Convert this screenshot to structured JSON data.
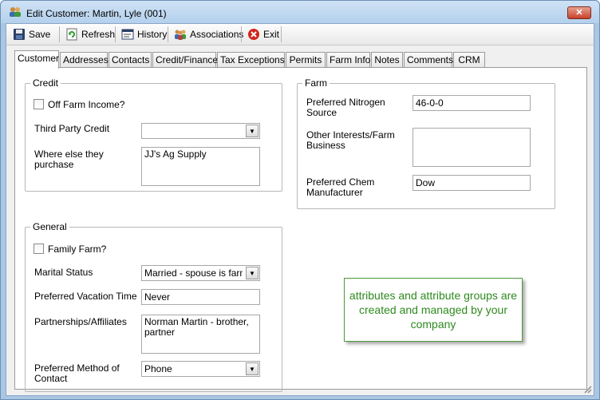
{
  "window": {
    "title": "Edit Customer: Martin, Lyle (001)",
    "close_glyph": "✕"
  },
  "toolbar": {
    "save": "Save",
    "refresh": "Refresh",
    "history": "History",
    "associations": "Associations",
    "exit": "Exit"
  },
  "tabs": [
    {
      "label": "Customer",
      "active": true
    },
    {
      "label": "Addresses"
    },
    {
      "label": "Contacts"
    },
    {
      "label": "Credit/Finance"
    },
    {
      "label": "Tax Exceptions"
    },
    {
      "label": "Permits"
    },
    {
      "label": "Farm Info"
    },
    {
      "label": "Notes"
    },
    {
      "label": "Comments"
    },
    {
      "label": "CRM"
    }
  ],
  "credit": {
    "title": "Credit",
    "off_farm_label": "Off Farm Income?",
    "off_farm_checked": false,
    "third_party_label": "Third Party Credit",
    "third_party_value": "",
    "where_else_label": "Where else they purchase",
    "where_else_value": "JJ's Ag Supply"
  },
  "general": {
    "title": "General",
    "family_farm_label": "Family Farm?",
    "family_farm_checked": false,
    "marital_label": "Marital Status",
    "marital_value": "Married - spouse is farm partner",
    "vacation_label": "Preferred Vacation Time",
    "vacation_value": "Never",
    "partnerships_label": "Partnerships/Affiliates",
    "partnerships_value": "Norman Martin - brother, partner",
    "contact_label": "Preferred Method of Contact",
    "contact_value": "Phone"
  },
  "farm": {
    "title": "Farm",
    "nitrogen_label": "Preferred Nitrogen Source",
    "nitrogen_value": "46-0-0",
    "interests_label": "Other Interests/Farm Business",
    "interests_value": "",
    "chem_label": "Preferred Chem Manufacturer",
    "chem_value": "Dow"
  },
  "callout": {
    "text": "attributes and attribute groups are created and managed by your company"
  },
  "colors": {
    "title_bar": "#b4d0ec",
    "callout_text": "#2e8a1e",
    "close_button": "#c8412a"
  }
}
